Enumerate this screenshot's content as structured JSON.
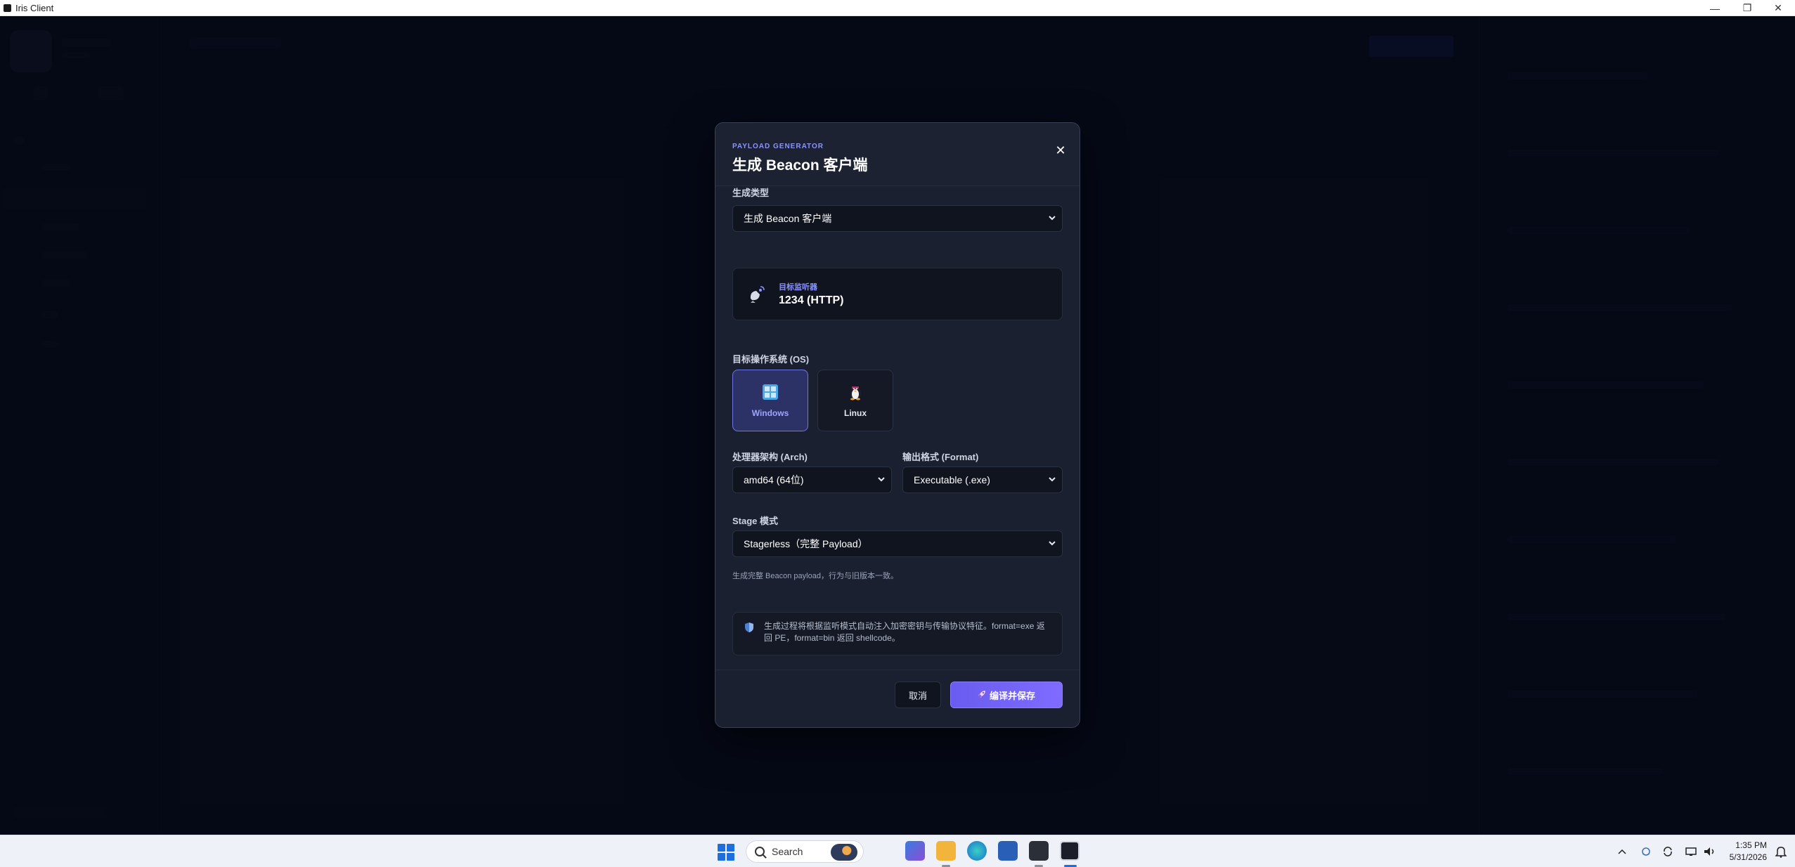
{
  "window": {
    "title": "Iris Client",
    "controls": {
      "minimize": "—",
      "restore": "❐",
      "close": "✕"
    }
  },
  "modal": {
    "eyebrow": "PAYLOAD GENERATOR",
    "title": "生成 Beacon 客户端",
    "close_glyph": "✕",
    "generate_type": {
      "label": "生成类型",
      "value": "生成 Beacon 客户端"
    },
    "listener": {
      "label": "目标监听器",
      "value": "1234 (HTTP)",
      "icon": "satellite-dish-icon"
    },
    "os": {
      "label": "目标操作系统 (OS)",
      "options": [
        {
          "name": "Windows",
          "icon": "windows-icon",
          "selected": true
        },
        {
          "name": "Linux",
          "icon": "linux-penguin-icon",
          "selected": false
        }
      ]
    },
    "arch": {
      "label": "处理器架构 (Arch)",
      "value": "amd64 (64位)"
    },
    "format": {
      "label": "输出格式 (Format)",
      "value": "Executable (.exe)"
    },
    "stage": {
      "label": "Stage 模式",
      "value": "Stagerless（完整 Payload）",
      "hint": "生成完整 Beacon payload，行为与旧版本一致。"
    },
    "note": {
      "icon": "shield-icon",
      "text": "生成过程将根据监听模式自动注入加密密钥与传输协议特征。format=exe 返回 PE，format=bin 返回 shellcode。"
    },
    "footer": {
      "cancel": "取消",
      "submit": "编译并保存",
      "submit_icon": "rocket-icon"
    }
  },
  "taskbar": {
    "search_placeholder": "Search",
    "clock_time": "1:35 PM",
    "clock_date": "5/31/2026",
    "accent": "#1d6fe0"
  },
  "colors": {
    "modal_bg": "#1a2030",
    "accent": "#7f6bff",
    "eyebrow": "#8b93ff",
    "overlay": "#030610"
  }
}
